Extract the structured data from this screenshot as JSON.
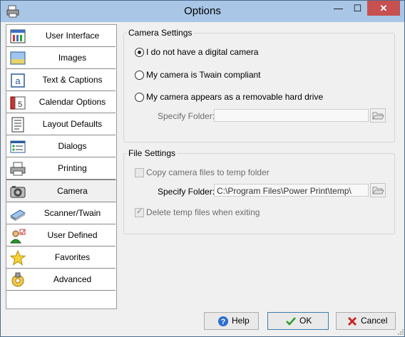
{
  "window": {
    "title": "Options"
  },
  "titlebar": {
    "minimize_icon": "minimize-icon",
    "maximize_icon": "maximize-icon",
    "close_icon": "close-icon",
    "close_glyph": "✕",
    "minimize_glyph": "—",
    "maximize_glyph": "☐"
  },
  "sidebar": {
    "items": [
      {
        "label": "User Interface",
        "icon": "user-interface-icon"
      },
      {
        "label": "Images",
        "icon": "images-icon"
      },
      {
        "label": "Text & Captions",
        "icon": "text-captions-icon"
      },
      {
        "label": "Calendar Options",
        "icon": "calendar-icon"
      },
      {
        "label": "Layout Defaults",
        "icon": "layout-icon"
      },
      {
        "label": "Dialogs",
        "icon": "dialogs-icon"
      },
      {
        "label": "Printing",
        "icon": "printer-icon"
      },
      {
        "label": "Camera",
        "icon": "camera-icon",
        "active": true
      },
      {
        "label": "Scanner/Twain",
        "icon": "scanner-icon"
      },
      {
        "label": "User Defined",
        "icon": "user-defined-icon"
      },
      {
        "label": "Favorites",
        "icon": "star-icon"
      },
      {
        "label": "Advanced",
        "icon": "advanced-gear-icon"
      }
    ]
  },
  "camera_settings": {
    "legend": "Camera Settings",
    "options": [
      {
        "label": "I do not have a digital camera",
        "selected": true
      },
      {
        "label": "My camera is Twain compliant",
        "selected": false
      },
      {
        "label": "My camera appears as a removable hard drive",
        "selected": false
      }
    ],
    "folder_label": "Specify Folder:",
    "folder_value": ""
  },
  "file_settings": {
    "legend": "File Settings",
    "copy_label": "Copy camera files to temp folder",
    "copy_checked": false,
    "folder_label": "Specify Folder:",
    "folder_value": "C:\\Program Files\\Power Print\\temp\\",
    "delete_label": "Delete temp files when exiting",
    "delete_checked": true
  },
  "buttons": {
    "help": "Help",
    "ok": "OK",
    "cancel": "Cancel"
  },
  "colors": {
    "titlebar": "#a9c6e6",
    "close": "#c75050",
    "ok_check": "#2f9a2f",
    "cancel_x": "#cc2222",
    "help_circle": "#2b6fd0"
  }
}
